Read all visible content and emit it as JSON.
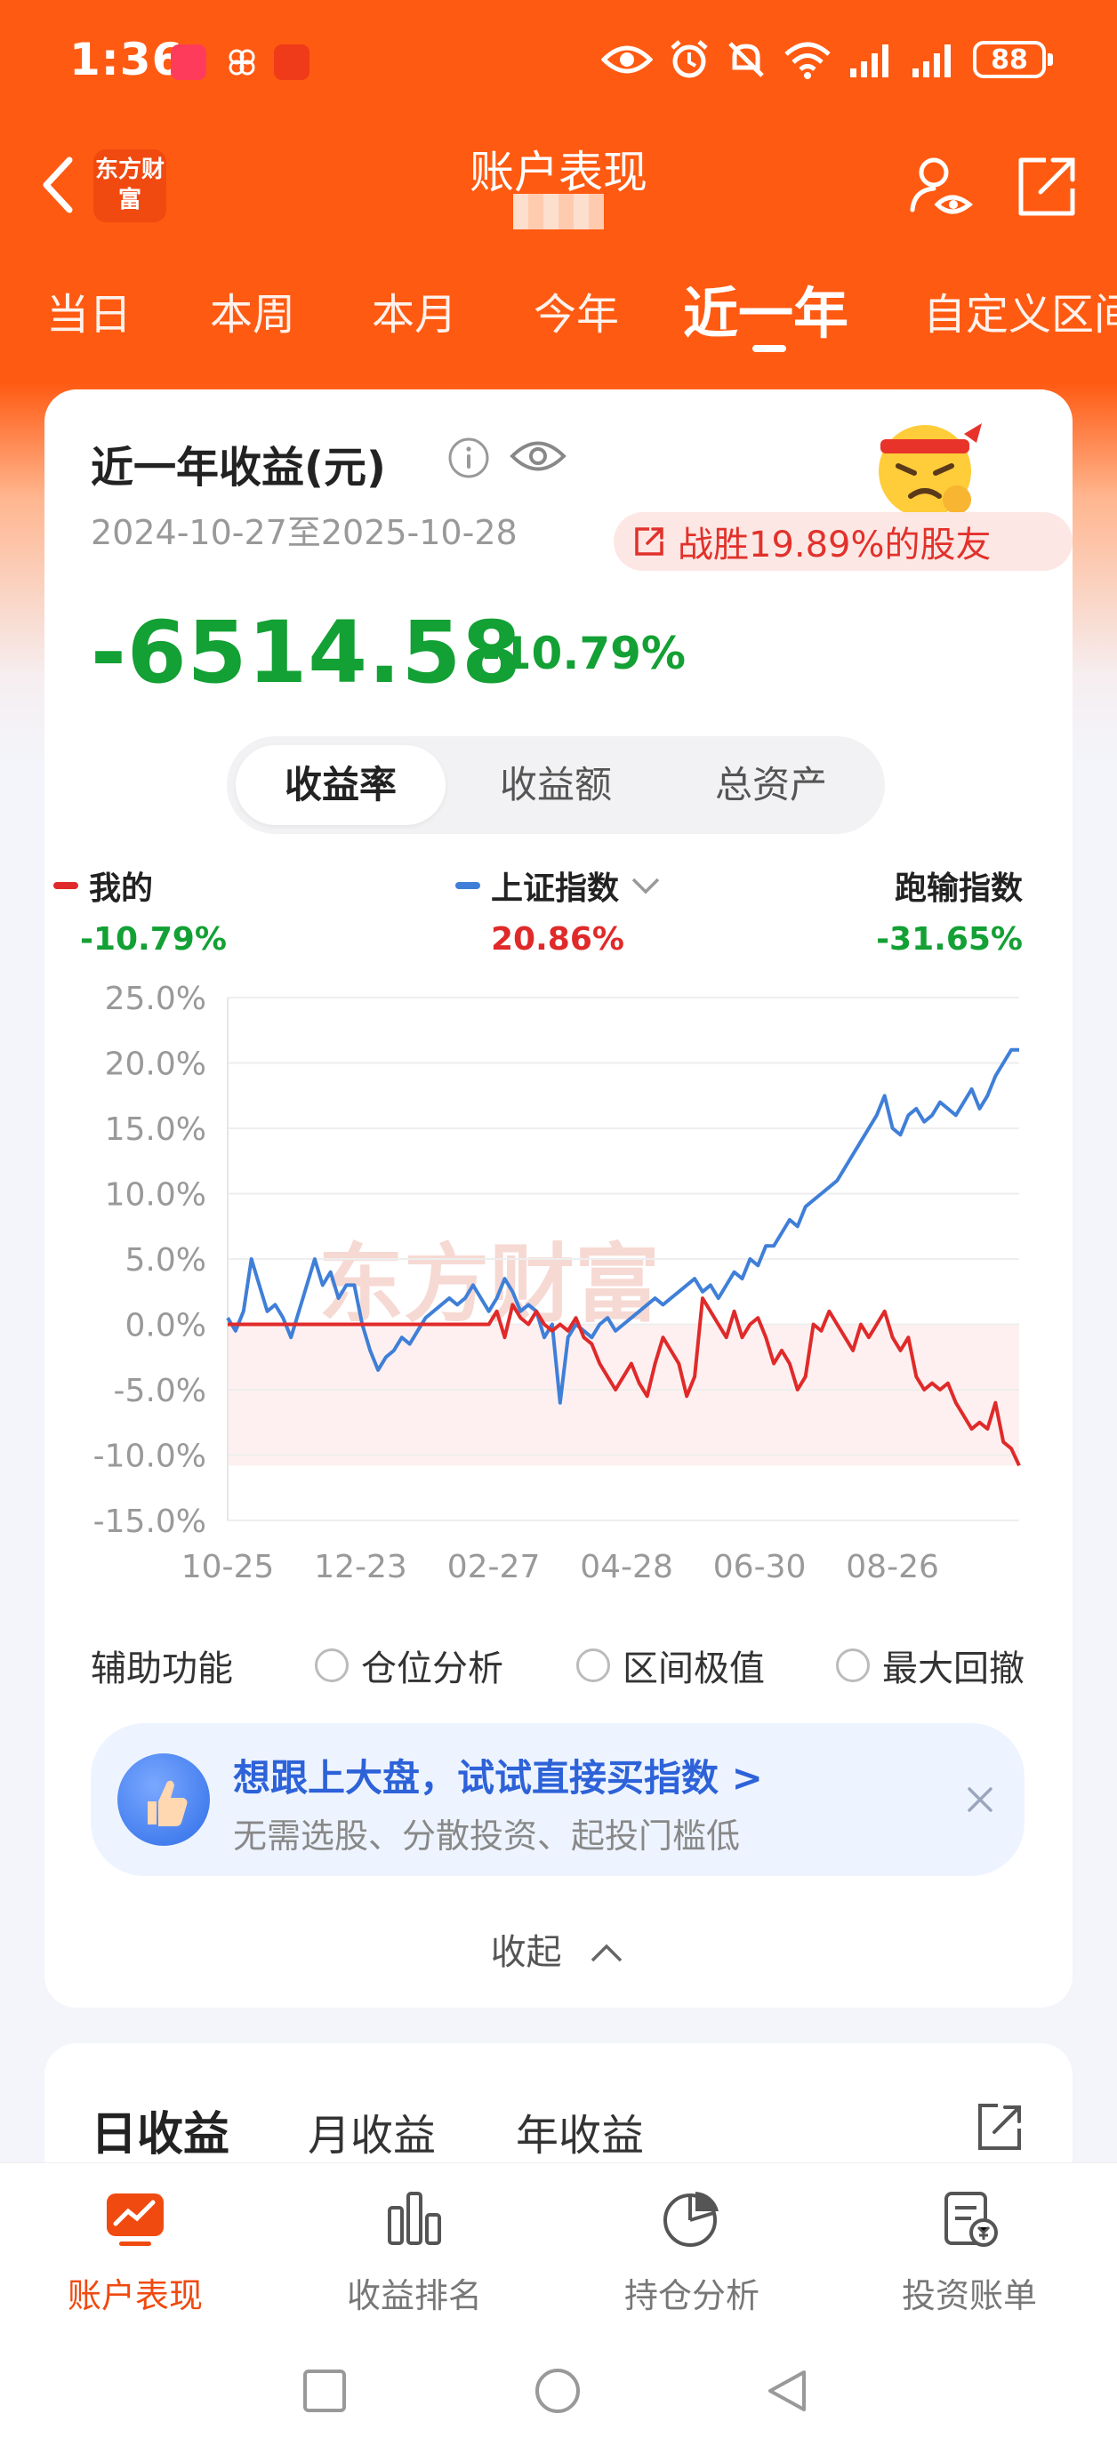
{
  "status_bar": {
    "time": "1:36",
    "battery": "88"
  },
  "header": {
    "title": "账户表现",
    "logo_text": "东方财富"
  },
  "tabs": [
    "当日",
    "本周",
    "本月",
    "今年",
    "近一年",
    "自定义区间"
  ],
  "summary": {
    "title": "近一年收益(元)",
    "date_range": "2024-10-27至2025-10-28",
    "beat_text": "战胜19.89%的股友",
    "profit": "-6514.58",
    "profit_pct": "-10.79%"
  },
  "segment": {
    "items": [
      "收益率",
      "收益额",
      "总资产"
    ],
    "active": 0
  },
  "legend": [
    {
      "name": "我的",
      "value": "-10.79%",
      "color": "#e02a2a",
      "value_color": "#13a034"
    },
    {
      "name": "上证指数",
      "value": "20.86%",
      "color": "#3f7fd8",
      "value_color": "#e02a2a"
    },
    {
      "name": "跑输指数",
      "value": "-31.65%",
      "value_color": "#13a034"
    }
  ],
  "chart_data": {
    "type": "line",
    "y_ticks": [
      "25.0%",
      "20.0%",
      "15.0%",
      "10.0%",
      "5.0%",
      "0.0%",
      "-5.0%",
      "-10.0%",
      "-15.0%"
    ],
    "x_ticks": [
      "10-25",
      "12-23",
      "02-27",
      "04-28",
      "06-30",
      "08-26"
    ],
    "ylim": [
      -15,
      25
    ],
    "x_range": [
      0,
      100
    ],
    "x_tick_positions": [
      0,
      16.8,
      33.6,
      50.4,
      67.2,
      84.0
    ],
    "series": [
      {
        "name": "上证指数",
        "color": "#3f7fd8",
        "points": [
          [
            0,
            0.5
          ],
          [
            1,
            -0.5
          ],
          [
            2,
            1
          ],
          [
            3,
            5
          ],
          [
            4,
            3
          ],
          [
            5,
            1
          ],
          [
            6,
            1.5
          ],
          [
            7,
            0.5
          ],
          [
            8,
            -1
          ],
          [
            9,
            1
          ],
          [
            10,
            3
          ],
          [
            11,
            5
          ],
          [
            12,
            3
          ],
          [
            13,
            4
          ],
          [
            14,
            2
          ],
          [
            15,
            3
          ],
          [
            16,
            3
          ],
          [
            17,
            0
          ],
          [
            18,
            -2
          ],
          [
            19,
            -3.5
          ],
          [
            20,
            -2.5
          ],
          [
            21,
            -2
          ],
          [
            22,
            -1
          ],
          [
            23,
            -1.5
          ],
          [
            24,
            -0.5
          ],
          [
            25,
            0.5
          ],
          [
            26,
            1
          ],
          [
            27,
            1.5
          ],
          [
            28,
            2
          ],
          [
            29,
            1.5
          ],
          [
            30,
            2
          ],
          [
            31,
            3
          ],
          [
            32,
            2
          ],
          [
            33,
            1
          ],
          [
            34,
            2
          ],
          [
            35,
            3.5
          ],
          [
            36,
            2.5
          ],
          [
            37,
            1
          ],
          [
            38,
            1.5
          ],
          [
            39,
            1
          ],
          [
            40,
            -1
          ],
          [
            41,
            0
          ],
          [
            42,
            -6
          ],
          [
            43,
            -1
          ],
          [
            44,
            0
          ],
          [
            45,
            -0.5
          ],
          [
            46,
            -1
          ],
          [
            47,
            0
          ],
          [
            48,
            0.5
          ],
          [
            49,
            -0.5
          ],
          [
            50,
            0
          ],
          [
            51,
            0.5
          ],
          [
            52,
            1
          ],
          [
            53,
            1.5
          ],
          [
            54,
            2
          ],
          [
            55,
            1.5
          ],
          [
            56,
            2
          ],
          [
            57,
            2.5
          ],
          [
            58,
            3
          ],
          [
            59,
            3.5
          ],
          [
            60,
            2.5
          ],
          [
            61,
            3
          ],
          [
            62,
            2
          ],
          [
            63,
            3
          ],
          [
            64,
            4
          ],
          [
            65,
            3.5
          ],
          [
            66,
            5
          ],
          [
            67,
            4.5
          ],
          [
            68,
            6
          ],
          [
            69,
            6
          ],
          [
            70,
            7
          ],
          [
            71,
            8
          ],
          [
            72,
            7.5
          ],
          [
            73,
            9
          ],
          [
            74,
            9.5
          ],
          [
            75,
            10
          ],
          [
            76,
            10.5
          ],
          [
            77,
            11
          ],
          [
            78,
            12
          ],
          [
            79,
            13
          ],
          [
            80,
            14
          ],
          [
            81,
            15
          ],
          [
            82,
            16
          ],
          [
            83,
            17.5
          ],
          [
            84,
            15
          ],
          [
            85,
            14.5
          ],
          [
            86,
            16
          ],
          [
            87,
            16.5
          ],
          [
            88,
            15.5
          ],
          [
            89,
            16
          ],
          [
            90,
            17
          ],
          [
            91,
            16.5
          ],
          [
            92,
            16
          ],
          [
            93,
            17
          ],
          [
            94,
            18
          ],
          [
            95,
            16.5
          ],
          [
            96,
            17.5
          ],
          [
            97,
            19
          ],
          [
            98,
            20
          ],
          [
            99,
            21
          ],
          [
            100,
            21
          ]
        ]
      },
      {
        "name": "我的",
        "color": "#e02a2a",
        "points": [
          [
            0,
            0
          ],
          [
            10,
            0
          ],
          [
            20,
            0
          ],
          [
            33,
            0
          ],
          [
            34,
            1
          ],
          [
            35,
            -1
          ],
          [
            36,
            1.5
          ],
          [
            37,
            0.5
          ],
          [
            38,
            0
          ],
          [
            39,
            1
          ],
          [
            40,
            0
          ],
          [
            41,
            -0.5
          ],
          [
            42,
            0
          ],
          [
            43,
            -0.5
          ],
          [
            44,
            0.5
          ],
          [
            45,
            -1
          ],
          [
            46,
            -1.5
          ],
          [
            47,
            -3
          ],
          [
            48,
            -4
          ],
          [
            49,
            -5
          ],
          [
            50,
            -4
          ],
          [
            51,
            -3
          ],
          [
            52,
            -4.5
          ],
          [
            53,
            -5.5
          ],
          [
            54,
            -3
          ],
          [
            55,
            -1
          ],
          [
            56,
            -2
          ],
          [
            57,
            -3
          ],
          [
            58,
            -5.5
          ],
          [
            59,
            -4
          ],
          [
            60,
            2
          ],
          [
            61,
            1
          ],
          [
            62,
            0
          ],
          [
            63,
            -1
          ],
          [
            64,
            1
          ],
          [
            65,
            -1
          ],
          [
            66,
            0
          ],
          [
            67,
            0.5
          ],
          [
            68,
            -1
          ],
          [
            69,
            -3
          ],
          [
            70,
            -2
          ],
          [
            71,
            -3
          ],
          [
            72,
            -5
          ],
          [
            73,
            -4
          ],
          [
            74,
            0
          ],
          [
            75,
            -0.5
          ],
          [
            76,
            1
          ],
          [
            77,
            0
          ],
          [
            78,
            -1
          ],
          [
            79,
            -2
          ],
          [
            80,
            0
          ],
          [
            81,
            -1
          ],
          [
            82,
            0
          ],
          [
            83,
            1
          ],
          [
            84,
            -1
          ],
          [
            85,
            -2
          ],
          [
            86,
            -1
          ],
          [
            87,
            -4
          ],
          [
            88,
            -5
          ],
          [
            89,
            -4.5
          ],
          [
            90,
            -5
          ],
          [
            91,
            -4.5
          ],
          [
            92,
            -6
          ],
          [
            93,
            -7
          ],
          [
            94,
            -8
          ],
          [
            95,
            -7.5
          ],
          [
            96,
            -8
          ],
          [
            97,
            -6
          ],
          [
            98,
            -9
          ],
          [
            99,
            -9.5
          ],
          [
            100,
            -10.8
          ]
        ]
      }
    ]
  },
  "aux": {
    "label": "辅助功能",
    "options": [
      "仓位分析",
      "区间极值",
      "最大回撤"
    ]
  },
  "promo": {
    "title": "想跟上大盘，试试直接买指数 >",
    "subtitle": "无需选股、分散投资、起投门槛低"
  },
  "collapse_label": "收起",
  "sub_tabs": [
    "日收益",
    "月收益",
    "年收益"
  ],
  "bottom_nav": [
    "账户表现",
    "收益排名",
    "持仓分析",
    "投资账单"
  ],
  "colors": {
    "brand": "#ff5a12",
    "gain": "#e02a2a",
    "loss": "#13a034",
    "index": "#3f7fd8"
  }
}
